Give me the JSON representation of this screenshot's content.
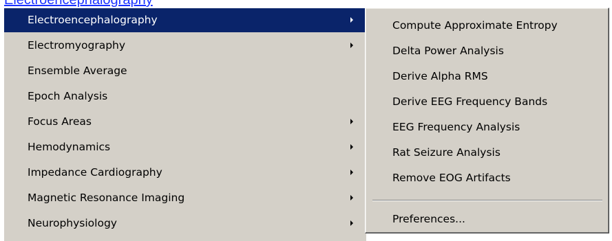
{
  "header": {
    "link_text": "Electroencephalography"
  },
  "main_menu": {
    "items": [
      {
        "label": "Electroencephalography",
        "has_submenu": true,
        "selected": true
      },
      {
        "label": "Electromyography",
        "has_submenu": true,
        "selected": false
      },
      {
        "label": "Ensemble Average",
        "has_submenu": false,
        "selected": false
      },
      {
        "label": "Epoch Analysis",
        "has_submenu": false,
        "selected": false
      },
      {
        "label": "Focus Areas",
        "has_submenu": true,
        "selected": false
      },
      {
        "label": "Hemodynamics",
        "has_submenu": true,
        "selected": false
      },
      {
        "label": "Impedance Cardiography",
        "has_submenu": true,
        "selected": false
      },
      {
        "label": "Magnetic Resonance Imaging",
        "has_submenu": true,
        "selected": false
      },
      {
        "label": "Neurophysiology",
        "has_submenu": true,
        "selected": false
      }
    ]
  },
  "submenu": {
    "items": [
      {
        "label": "Compute Approximate Entropy"
      },
      {
        "label": "Delta Power Analysis"
      },
      {
        "label": "Derive Alpha RMS"
      },
      {
        "label": "Derive EEG Frequency Bands"
      },
      {
        "label": "EEG Frequency Analysis"
      },
      {
        "label": "Rat Seizure Analysis"
      },
      {
        "label": "Remove EOG Artifacts"
      }
    ],
    "preferences_label": "Preferences..."
  },
  "colors": {
    "menu_background": "#d4d0c8",
    "selection_background": "#0a246a",
    "selection_text": "#ffffff",
    "link": "#1a32ff"
  }
}
